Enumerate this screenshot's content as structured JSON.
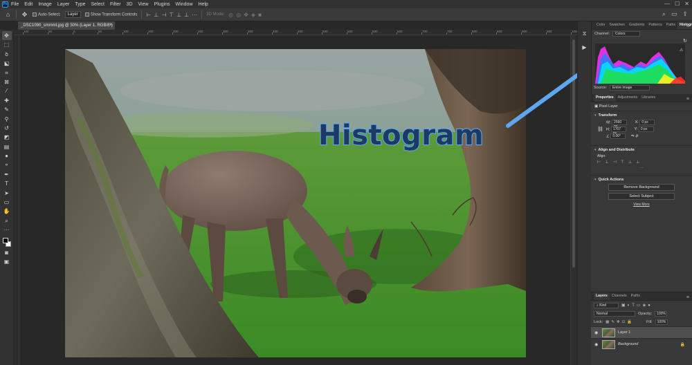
{
  "menubar": {
    "items": [
      "File",
      "Edit",
      "Image",
      "Layer",
      "Type",
      "Select",
      "Filter",
      "3D",
      "View",
      "Plugins",
      "Window",
      "Help"
    ]
  },
  "options": {
    "auto_select_label": "Auto-Select:",
    "auto_select_value": "Layer",
    "transform_controls_label": "Show Transform Controls",
    "mode_3d_label": "3D Mode:"
  },
  "document": {
    "tab_title": "_DSC1090_smmmt.jpg @ 50% (Layer 1, RGB/8*)",
    "close": "×"
  },
  "ruler": {
    "h_labels": [
      "100",
      "50",
      "0",
      "50",
      "100",
      "150",
      "200",
      "250",
      "300",
      "350",
      "400",
      "450",
      "500",
      "550",
      "600",
      "650",
      "700",
      "750",
      "800",
      "850",
      "900",
      "950",
      "1000"
    ]
  },
  "annotation": {
    "text": "Histogram",
    "arrow_color": "#5ea6ee"
  },
  "histogram_panel": {
    "tabs": [
      "Color",
      "Swatches",
      "Gradients",
      "Patterns",
      "Paths",
      "Histogram"
    ],
    "active_tab": "Histogram",
    "channel_label": "Channel:",
    "channel_value": "Colors",
    "source_label": "Source:",
    "source_value": "Entire Image"
  },
  "properties_panel": {
    "tabs": [
      "Properties",
      "Adjustments",
      "Libraries"
    ],
    "layer_type": "Pixel Layer",
    "transform": {
      "title": "Transform",
      "w_label": "W:",
      "w_value": "2560 px",
      "h_label": "H:",
      "h_value": "1707 px",
      "x_label": "X:",
      "x_value": "0 px",
      "y_label": "Y:",
      "y_value": "0 px",
      "angle_value": "0.00°"
    },
    "align": {
      "title": "Align and Distribute",
      "align_label": "Align:"
    },
    "quick_actions": {
      "title": "Quick Actions",
      "remove_bg": "Remove Background",
      "select_subject": "Select Subject",
      "view_more": "View More"
    }
  },
  "layers_panel": {
    "tabs": [
      "Layers",
      "Channels",
      "Paths"
    ],
    "kind_label": "Kind",
    "blend_mode": "Normal",
    "opacity_label": "Opacity:",
    "opacity_value": "100%",
    "lock_label": "Lock:",
    "fill_label": "Fill:",
    "fill_value": "100%",
    "layers": [
      {
        "name": "Layer 1",
        "selected": true
      },
      {
        "name": "Background",
        "selected": false
      }
    ]
  },
  "histogram_data": {
    "colors": {
      "red": "#ff2a2a",
      "green": "#22dd44",
      "blue": "#2a7cff",
      "cyan": "#00e5ff",
      "magenta": "#ff33ff",
      "yellow": "#ffee22"
    }
  }
}
